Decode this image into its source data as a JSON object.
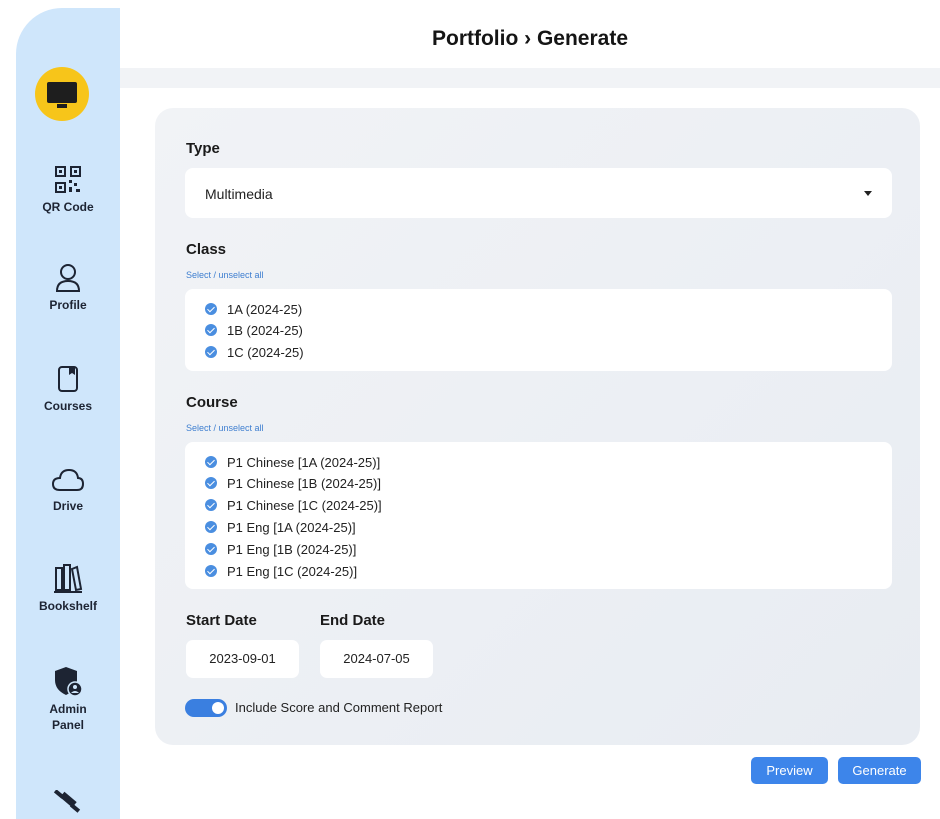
{
  "header": {
    "title": "Portfolio › Generate"
  },
  "sidebar": {
    "items": [
      {
        "label": "QR Code",
        "icon": "qr-code-icon"
      },
      {
        "label": "Profile",
        "icon": "user-icon"
      },
      {
        "label": "Courses",
        "icon": "book-icon"
      },
      {
        "label": "Drive",
        "icon": "cloud-icon"
      },
      {
        "label": "Bookshelf",
        "icon": "books-icon"
      },
      {
        "label": "Admin Panel",
        "icon": "shield-user-icon"
      }
    ]
  },
  "form": {
    "type": {
      "label": "Type",
      "value": "Multimedia"
    },
    "class": {
      "label": "Class",
      "select_all": "Select / unselect all",
      "items": [
        "1A (2024-25)",
        "1B (2024-25)",
        "1C (2024-25)"
      ]
    },
    "course": {
      "label": "Course",
      "select_all": "Select / unselect all",
      "items": [
        "P1 Chinese [1A (2024-25)]",
        "P1 Chinese [1B (2024-25)]",
        "P1 Chinese [1C (2024-25)]",
        "P1 Eng [1A (2024-25)]",
        "P1 Eng [1B (2024-25)]",
        "P1 Eng [1C (2024-25)]"
      ]
    },
    "start_date": {
      "label": "Start Date",
      "value": "2023-09-01"
    },
    "end_date": {
      "label": "End Date",
      "value": "2024-07-05"
    },
    "include_report": {
      "label": "Include Score and Comment Report",
      "checked": true
    }
  },
  "actions": {
    "preview": "Preview",
    "generate": "Generate"
  },
  "colors": {
    "accent": "#3d85ea",
    "sidebar": "#cfe6fb",
    "logo": "#f7c51a"
  }
}
